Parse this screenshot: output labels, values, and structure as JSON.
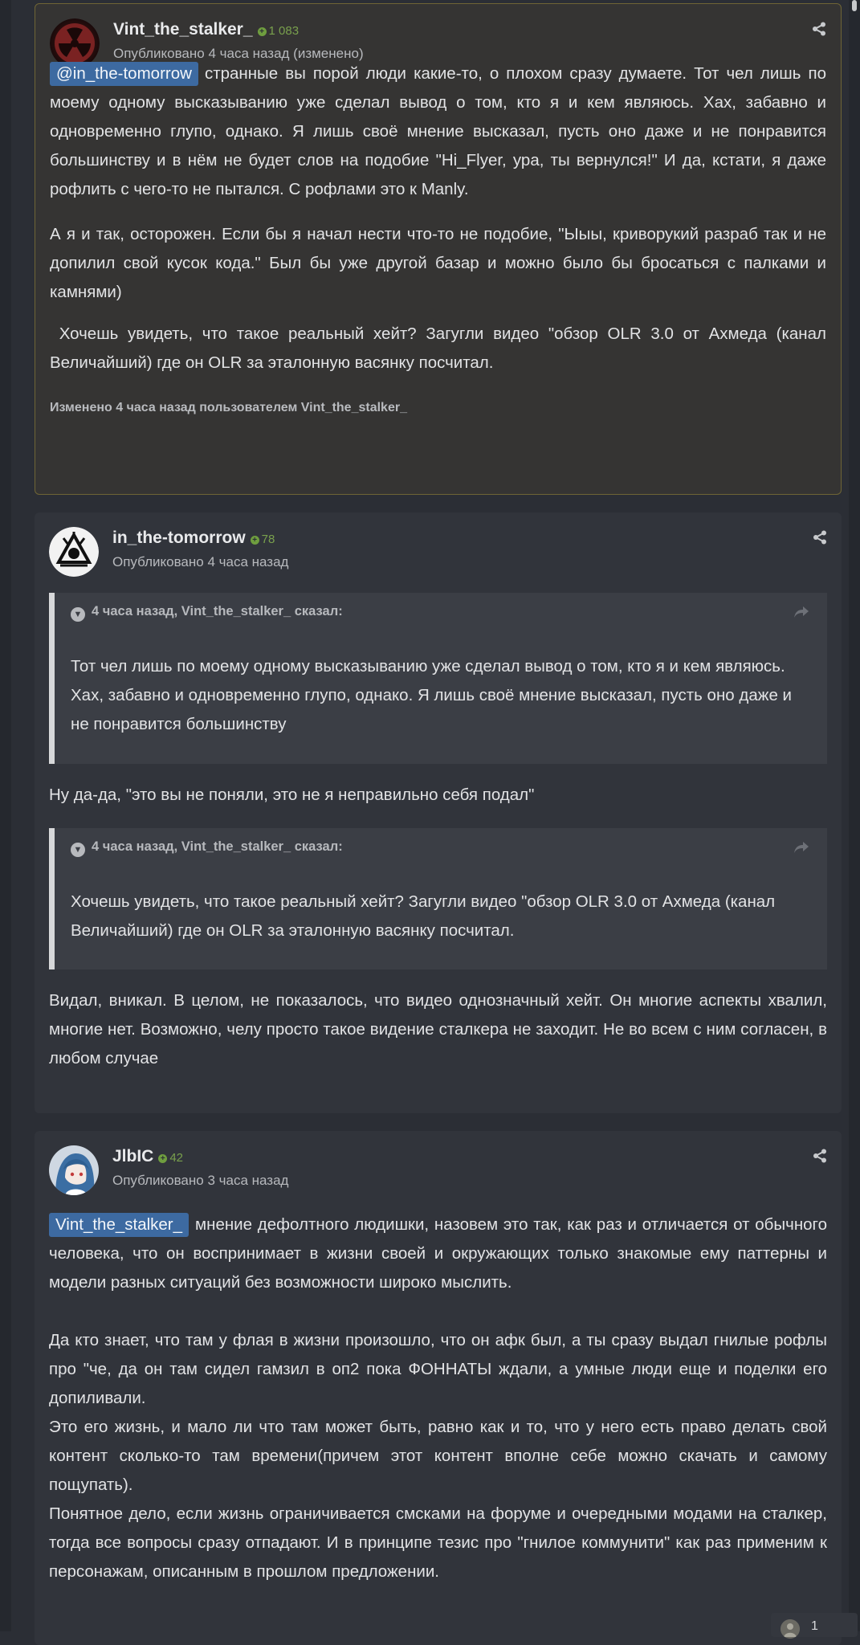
{
  "posts": [
    {
      "author": "Vint_the_stalker_",
      "reputation": "1 083",
      "meta": "Опубликовано 4 часа назад (изменено)",
      "mention": "@in_the-tomorrow",
      "p1": "странные вы порой люди какие-то, о плохом сразу думаете. Тот чел лишь по моему одному высказыванию уже сделал вывод о том, кто я и кем являюсь. Хах, забавно и одновременно глупо, однако. Я лишь своё мнение высказал, пусть оно даже и не понравится большинству и в нём не будет слов на подобие \"Hi_Flyer, ура, ты вернулся!\" И да, кстати, я даже рофлить с чего-то не пытался. С рофлами это к Manly.",
      "p2": "А я и так, осторожен. Если бы я начал нести что-то не подобие, \"Ыыы, криворукий разраб так и не допилил свой кусок кода.\" Был бы уже другой базар и можно было бы бросаться с палками и камнями)",
      "p3": " Хочешь увидеть, что такое реальный хейт? Загугли видео \"обзор OLR 3.0 от Ахмеда (канал Величайший) где он OLR за эталонную васянку посчитал.",
      "edited": "Изменено 4 часа назад пользователем Vint_the_stalker_"
    },
    {
      "author": "in_the-tomorrow",
      "reputation": "78",
      "meta": "Опубликовано 4 часа назад",
      "quote1_head": "4 часа назад, Vint_the_stalker_ сказал:",
      "quote1_body": "Тот чел лишь по моему одному высказыванию уже сделал вывод о том, кто я и кем являюсь. Хах, забавно и одновременно глупо, однако. Я лишь своё мнение высказал, пусть оно даже и не понравится большинству",
      "reply1": "Ну да-да, \"это вы не поняли, это не я неправильно себя подал\"",
      "quote2_head": "4 часа назад, Vint_the_stalker_ сказал:",
      "quote2_body": "Хочешь увидеть, что такое реальный хейт? Загугли видео \"обзор OLR 3.0 от Ахмеда (канал Величайший) где он OLR за эталонную васянку посчитал.",
      "reply2": "Видал, вникал. В целом, не показалось, что видео однозначный хейт. Он многие аспекты хвалил, многие нет. Возможно, челу просто такое видение сталкера не заходит. Не во всем с ним согласен, в любом случае"
    },
    {
      "author": "JlbIC",
      "reputation": "42",
      "meta": "Опубликовано 3 часа назад",
      "mention": "Vint_the_stalker_",
      "p1": "мнение дефолтного людишки, назовем это так, как раз и отличается от обычного человека, что он воспринимает в жизни своей и окружающих только знакомые ему паттерны и модели разных ситуаций без возможности широко мыслить.",
      "p2": "Да кто знает, что там у флая в жизни произошло, что он афк был, а ты сразу выдал гнилые рофлы про \"че, да он там сидел гамзил в оп2 пока ФОННАТЫ ждали, а умные люди еще и поделки его допиливали.",
      "p3": "Это его жизнь, и мало ли что там может быть, равно как и то, что у него есть право делать свой контент сколько-то там времени(причем этот контент вполне себе можно скачать и самому пощупать).",
      "p4": "Понятное дело, если жизнь ограничивается смсками на форуме и очередными модами на сталкер, тогда все вопросы сразу отпадают. И в принципе тезис про \"гнилое коммунити\" как раз применим к персонажам, описанным в прошлом предложении."
    }
  ],
  "reaction_count": "1",
  "colors": {
    "background": "#2b2e35",
    "post": "#31343b",
    "highlight_border": "#6f6535",
    "mention": "#3d6aa1",
    "reputation": "#79a04d"
  },
  "icons": [
    "share-icon",
    "reputation-plus-icon",
    "quote-expand-icon",
    "quote-goto-icon",
    "reaction-avatar-icon"
  ]
}
